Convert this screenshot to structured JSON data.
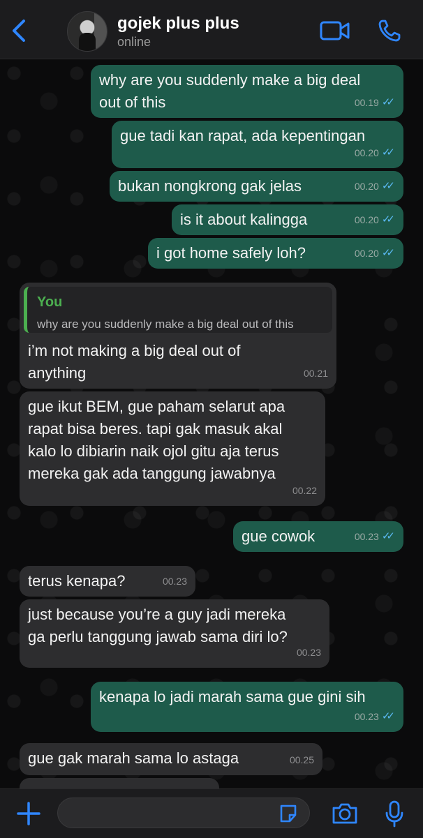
{
  "header": {
    "contact_name": "gojek plus plus",
    "status": "online"
  },
  "icons": {
    "back": "chevron-left-icon",
    "video": "video-camera-icon",
    "call": "phone-icon",
    "plus": "plus-icon",
    "sticker": "sticker-icon",
    "camera": "camera-icon",
    "mic": "microphone-icon",
    "read_receipt": "double-check-icon"
  },
  "colors": {
    "outgoing_bubble": "#1e5b4b",
    "incoming_bubble": "#2d2d2f",
    "accent_blue": "#2f86ff",
    "quote_name": "#4caf50",
    "read_ticks": "#5ab8f2"
  },
  "messages": [
    {
      "dir": "out",
      "text": "why are you suddenly make a big deal\nout of this",
      "time": "00.19",
      "read": true
    },
    {
      "dir": "out",
      "text": "gue tadi kan rapat, ada kepentingan",
      "time": "00.20",
      "read": true
    },
    {
      "dir": "out",
      "text": "bukan nongkrong gak jelas",
      "time": "00.20",
      "read": true
    },
    {
      "dir": "out",
      "text": "is it about kalingga",
      "time": "00.20",
      "read": true
    },
    {
      "dir": "out",
      "text": "i got home safely loh?",
      "time": "00.20",
      "read": true
    },
    {
      "dir": "in",
      "quote_author": "You",
      "quote_text": "why are you suddenly make a big deal out of this",
      "text": "i’m not making a big deal out of\nanything",
      "time": "00.21"
    },
    {
      "dir": "in",
      "text": "gue ikut BEM, gue paham selarut apa\nrapat bisa beres. tapi gak masuk akal\nkalo lo dibiarin naik ojol gitu aja terus\nmereka gak ada tanggung jawabnya",
      "time": "00.22"
    },
    {
      "dir": "out",
      "text": "gue cowok",
      "time": "00.23",
      "read": true
    },
    {
      "dir": "in",
      "text": "terus kenapa?",
      "time": "00.23"
    },
    {
      "dir": "in",
      "text": "just because you’re a guy jadi mereka\nga perlu tanggung jawab sama diri lo?",
      "time": "00.23"
    },
    {
      "dir": "out",
      "text": "kenapa lo jadi marah sama gue gini sih",
      "time": "00.23",
      "read": true
    },
    {
      "dir": "in",
      "text": "gue gak marah sama lo astaga",
      "time": "00.25"
    }
  ],
  "composer": {
    "input_value": ""
  }
}
